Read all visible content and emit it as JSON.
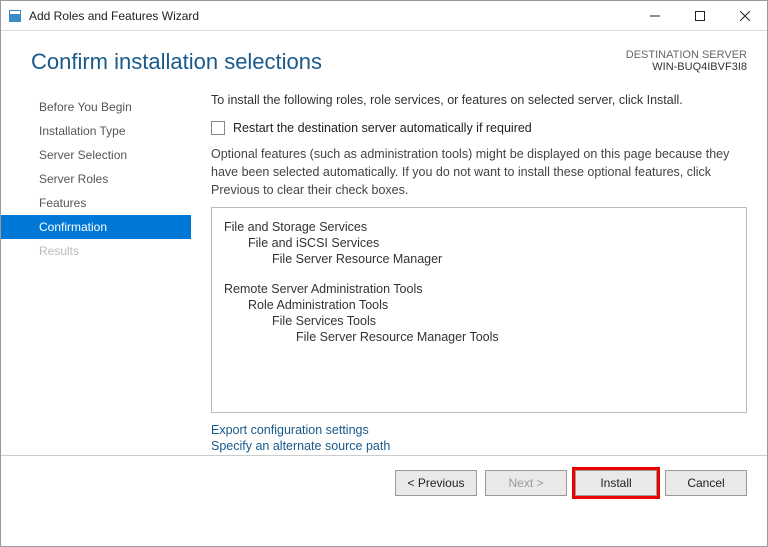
{
  "titlebar": {
    "title": "Add Roles and Features Wizard"
  },
  "header": {
    "title": "Confirm installation selections",
    "dest_label": "DESTINATION SERVER",
    "dest_server": "WIN-BUQ4IBVF3I8"
  },
  "sidebar": {
    "items": [
      {
        "label": "Before You Begin",
        "active": false,
        "disabled": false
      },
      {
        "label": "Installation Type",
        "active": false,
        "disabled": false
      },
      {
        "label": "Server Selection",
        "active": false,
        "disabled": false
      },
      {
        "label": "Server Roles",
        "active": false,
        "disabled": false
      },
      {
        "label": "Features",
        "active": false,
        "disabled": false
      },
      {
        "label": "Confirmation",
        "active": true,
        "disabled": false
      },
      {
        "label": "Results",
        "active": false,
        "disabled": true
      }
    ]
  },
  "content": {
    "intro": "To install the following roles, role services, or features on selected server, click Install.",
    "restart_checkbox": "Restart the destination server automatically if required",
    "optional_note": "Optional features (such as administration tools) might be displayed on this page because they have been selected automatically. If you do not want to install these optional features, click Previous to clear their check boxes.",
    "features": [
      {
        "level": 0,
        "text": "File and Storage Services"
      },
      {
        "level": 1,
        "text": "File and iSCSI Services"
      },
      {
        "level": 2,
        "text": "File Server Resource Manager"
      },
      {
        "gap": true
      },
      {
        "level": 0,
        "text": "Remote Server Administration Tools"
      },
      {
        "level": 1,
        "text": "Role Administration Tools"
      },
      {
        "level": 2,
        "text": "File Services Tools"
      },
      {
        "level": 3,
        "text": "File Server Resource Manager Tools"
      }
    ],
    "export_link": "Export configuration settings",
    "alt_source_link": "Specify an alternate source path"
  },
  "footer": {
    "previous": "< Previous",
    "next": "Next >",
    "install": "Install",
    "cancel": "Cancel"
  }
}
